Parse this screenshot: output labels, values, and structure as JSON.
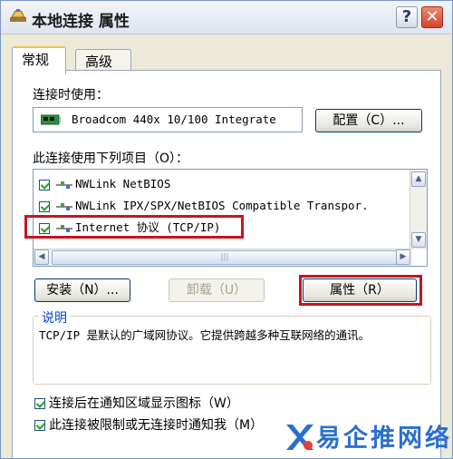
{
  "window": {
    "title": "本地连接 属性",
    "help_label": "?",
    "close_label": "✕"
  },
  "tabs": [
    {
      "label": "常规",
      "active": true
    },
    {
      "label": "高级",
      "active": false
    }
  ],
  "connect_using": {
    "label": "连接时使用：",
    "device": "Broadcom 440x 10/100 Integrate",
    "icon": "network-card-icon",
    "configure_label": "配置（C）..."
  },
  "components": {
    "label": "此连接使用下列项目（O）：",
    "items": [
      {
        "label": "NWLink NetBIOS",
        "checked": true,
        "icon": "protocol-icon"
      },
      {
        "label": "NWLink IPX/SPX/NetBIOS Compatible Transpor.",
        "checked": true,
        "icon": "protocol-icon"
      },
      {
        "label": "Internet 协议 (TCP/IP)",
        "checked": true,
        "icon": "protocol-icon",
        "highlighted": true
      }
    ],
    "scroll_up": "▲",
    "scroll_down": "▼",
    "scroll_left": "◀",
    "scroll_right": "▶",
    "thumb_grip": "|||"
  },
  "actions": {
    "install_label": "安装（N）...",
    "uninstall_label": "卸载（U）",
    "properties_label": "属性（R）",
    "uninstall_enabled": false
  },
  "description": {
    "legend": "说明",
    "text": "TCP/IP 是默认的广域网协议。它提供跨越多种互联网络的通讯。"
  },
  "options": [
    {
      "label": "连接后在通知区域显示图标（W）",
      "checked": true
    },
    {
      "label": "此连接被限制或无连接时通知我（M）",
      "checked": true
    }
  ],
  "watermark": {
    "text": "易企推网络",
    "icon": "blue-x-logo-icon"
  },
  "colors": {
    "highlight": "#c8141e",
    "accent": "#0046d5",
    "window_bg": "#ece9d8"
  }
}
